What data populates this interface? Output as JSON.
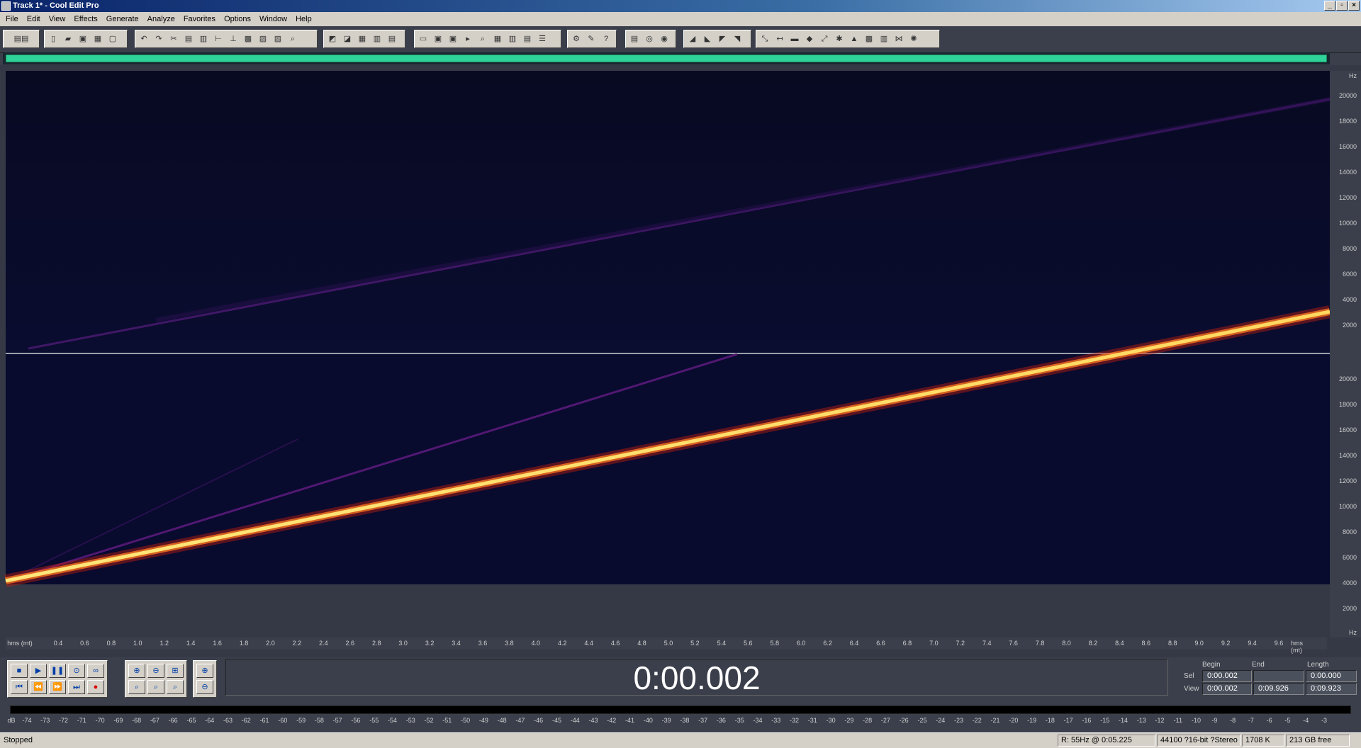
{
  "window": {
    "title": "Track 1* - Cool Edit Pro"
  },
  "menu": [
    "File",
    "Edit",
    "View",
    "Effects",
    "Generate",
    "Analyze",
    "Favorites",
    "Options",
    "Window",
    "Help"
  ],
  "spectrogram": {
    "hz_unit": "Hz",
    "freq_ticks": [
      "20000",
      "18000",
      "16000",
      "14000",
      "12000",
      "10000",
      "8000",
      "6000",
      "4000",
      "2000"
    ],
    "time_unit": "hms (mt)",
    "time_ticks": [
      "0.4",
      "0.6",
      "0.8",
      "1.0",
      "1.2",
      "1.4",
      "1.6",
      "1.8",
      "2.0",
      "2.2",
      "2.4",
      "2.6",
      "2.8",
      "3.0",
      "3.2",
      "3.4",
      "3.6",
      "3.8",
      "4.0",
      "4.2",
      "4.4",
      "4.6",
      "4.8",
      "5.0",
      "5.2",
      "5.4",
      "5.6",
      "5.8",
      "6.0",
      "6.2",
      "6.4",
      "6.6",
      "6.8",
      "7.0",
      "7.2",
      "7.4",
      "7.6",
      "7.8",
      "8.0",
      "8.2",
      "8.4",
      "8.6",
      "8.8",
      "9.0",
      "9.2",
      "9.4",
      "9.6"
    ],
    "background_color": "#070a24",
    "bright_sweep_color": "#ffd860",
    "faint_sweep_color": "#5a1a7a"
  },
  "transport": {
    "time_display": "0:00.002",
    "columns": {
      "begin": "Begin",
      "end": "End",
      "length": "Length"
    },
    "sel": {
      "label": "Sel",
      "begin": "0:00.002",
      "end": "",
      "length": "0:00.000"
    },
    "view": {
      "label": "View",
      "begin": "0:00.002",
      "end": "0:09.926",
      "length": "0:09.923"
    }
  },
  "meter": {
    "left_label": "dB",
    "db_ticks": [
      "-74",
      "-73",
      "-72",
      "-71",
      "-70",
      "-69",
      "-68",
      "-67",
      "-66",
      "-65",
      "-64",
      "-63",
      "-62",
      "-61",
      "-60",
      "-59",
      "-58",
      "-57",
      "-56",
      "-55",
      "-54",
      "-53",
      "-52",
      "-51",
      "-50",
      "-49",
      "-48",
      "-47",
      "-46",
      "-45",
      "-44",
      "-43",
      "-42",
      "-41",
      "-40",
      "-39",
      "-38",
      "-37",
      "-36",
      "-35",
      "-34",
      "-33",
      "-32",
      "-31",
      "-30",
      "-29",
      "-28",
      "-27",
      "-26",
      "-25",
      "-24",
      "-23",
      "-22",
      "-21",
      "-20",
      "-19",
      "-18",
      "-17",
      "-16",
      "-15",
      "-14",
      "-13",
      "-12",
      "-11",
      "-10",
      "-9",
      "-8",
      "-7",
      "-6",
      "-5",
      "-4",
      "-3"
    ]
  },
  "status": {
    "state": "Stopped",
    "resolution": "R: 55Hz @  0:05.225",
    "format": "44100 ?16-bit ?Stereo",
    "size": "1708 K",
    "free": "213 GB free"
  }
}
